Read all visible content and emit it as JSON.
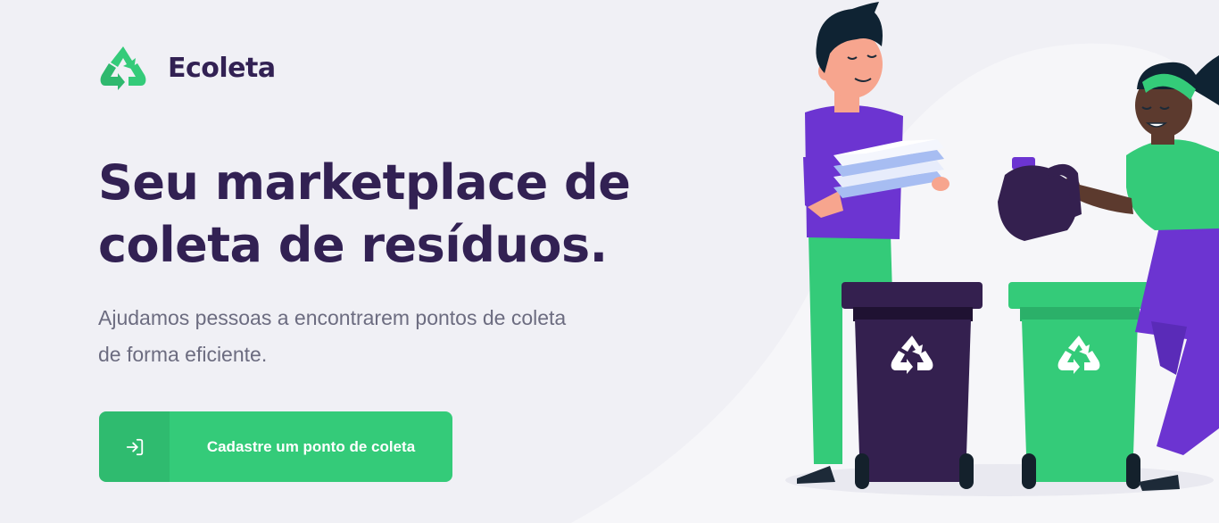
{
  "header": {
    "brand_name": "Ecoleta",
    "logo_icon": "recycle-icon"
  },
  "hero": {
    "title_line1": "Seu marketplace de",
    "title_line2": "coleta de resíduos.",
    "subtitle_line1": "Ajudamos pessoas a encontrarem pontos de coleta",
    "subtitle_line2": "de forma eficiente."
  },
  "cta": {
    "label": "Cadastre um ponto de coleta",
    "icon": "log-in-icon"
  },
  "illustration": {
    "name": "people-recycling-illustration",
    "icons": [
      "recycle-icon",
      "recycle-icon"
    ]
  },
  "colors": {
    "background": "#f0f0f5",
    "title": "#322153",
    "text": "#6c6c80",
    "primary": "#34cb79",
    "bin_dark": "#34204f",
    "shirt_purple": "#6c34d1"
  }
}
